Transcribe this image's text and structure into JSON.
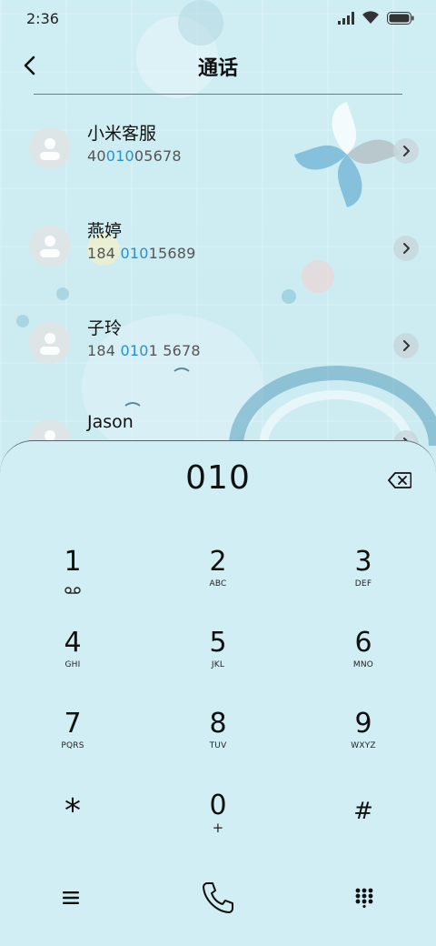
{
  "status_bar": {
    "time": "2:36",
    "icons": [
      "signal-icon",
      "wifi-icon",
      "battery-icon"
    ]
  },
  "header": {
    "title": "通话",
    "back_icon": "chevron-left-icon"
  },
  "contacts": [
    {
      "name": "小米客服",
      "number_parts": [
        {
          "text": "40",
          "highlight": false
        },
        {
          "text": "010",
          "highlight": true
        },
        {
          "text": "05678",
          "highlight": false
        }
      ]
    },
    {
      "name": "燕婷",
      "number_parts": [
        {
          "text": "184 ",
          "highlight": false
        },
        {
          "text": "010",
          "highlight": true
        },
        {
          "text": "15689",
          "highlight": false
        }
      ]
    },
    {
      "name": "子玲",
      "number_parts": [
        {
          "text": "184 ",
          "highlight": false
        },
        {
          "text": "010",
          "highlight": true
        },
        {
          "text": "1 5678",
          "highlight": false
        }
      ]
    },
    {
      "name": "Jason",
      "number_parts": []
    }
  ],
  "dialpad": {
    "display_number": "010",
    "keys": [
      {
        "digit": "1",
        "letters": "",
        "icon": "voicemail-icon"
      },
      {
        "digit": "2",
        "letters": "ABC"
      },
      {
        "digit": "3",
        "letters": "DEF"
      },
      {
        "digit": "4",
        "letters": "GHI"
      },
      {
        "digit": "5",
        "letters": "JKL"
      },
      {
        "digit": "6",
        "letters": "MNO"
      },
      {
        "digit": "7",
        "letters": "PQRS"
      },
      {
        "digit": "8",
        "letters": "TUV"
      },
      {
        "digit": "9",
        "letters": "WXYZ"
      },
      {
        "digit": "*",
        "letters": ""
      },
      {
        "digit": "0",
        "letters": "+"
      },
      {
        "digit": "#",
        "letters": ""
      }
    ]
  },
  "bottom_bar": {
    "buttons": [
      "menu-icon",
      "call-icon",
      "dialpad-icon"
    ]
  },
  "colors": {
    "background": "#cfecf2",
    "highlight": "#2a90c8",
    "text": "#111111"
  }
}
